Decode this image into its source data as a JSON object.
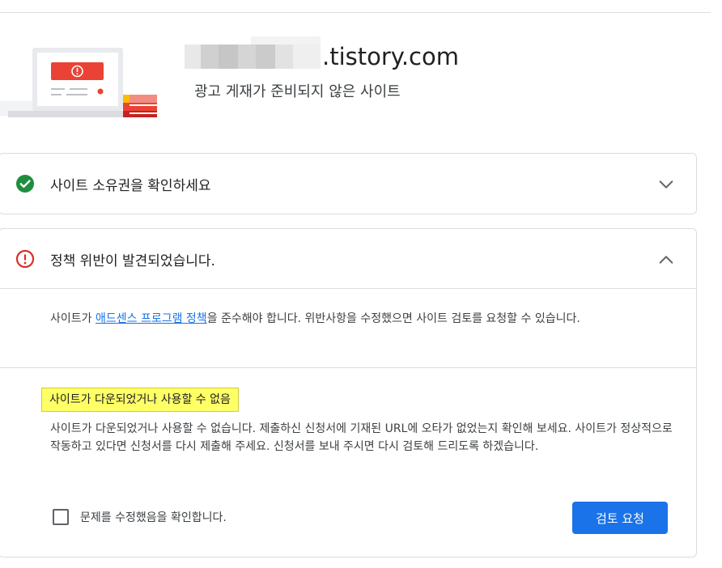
{
  "header": {
    "site_domain": ".tistory.com",
    "site_status": "광고 게재가 준비되지 않은 사이트"
  },
  "sections": [
    {
      "title": "사이트 소유권을 확인하세요",
      "status": "ok",
      "expanded": false,
      "icon": "check-circle-icon"
    },
    {
      "title": "정책 위반이 발견되었습니다.",
      "status": "error",
      "expanded": true,
      "icon": "error-circle-icon",
      "description_prefix": "사이트가 ",
      "description_link": "애드센스 프로그램 정책",
      "description_suffix": "을 준수해야 합니다. 위반사항을 수정했으면 사이트 검토를 요청할 수 있습니다.",
      "issue": {
        "label": "사이트가 다운되었거나 사용할 수 없음",
        "text": "사이트가 다운되었거나 사용할 수 없습니다. 제출하신 신청서에 기재된 URL에 오타가 없었는지 확인해 보세요. 사이트가 정상적으로 작동하고 있다면 신청서를 다시 제출해 주세요. 신청서를 보내 주시면 다시 검토해 드리도록 하겠습니다."
      },
      "confirm_label": "문제를 수정했음을 확인합니다.",
      "confirm_checked": false,
      "review_button": "검토 요청"
    }
  ],
  "colors": {
    "accent": "#1a73e8",
    "success": "#1e8e3e",
    "error": "#d93025",
    "highlight": "#ffff66"
  }
}
